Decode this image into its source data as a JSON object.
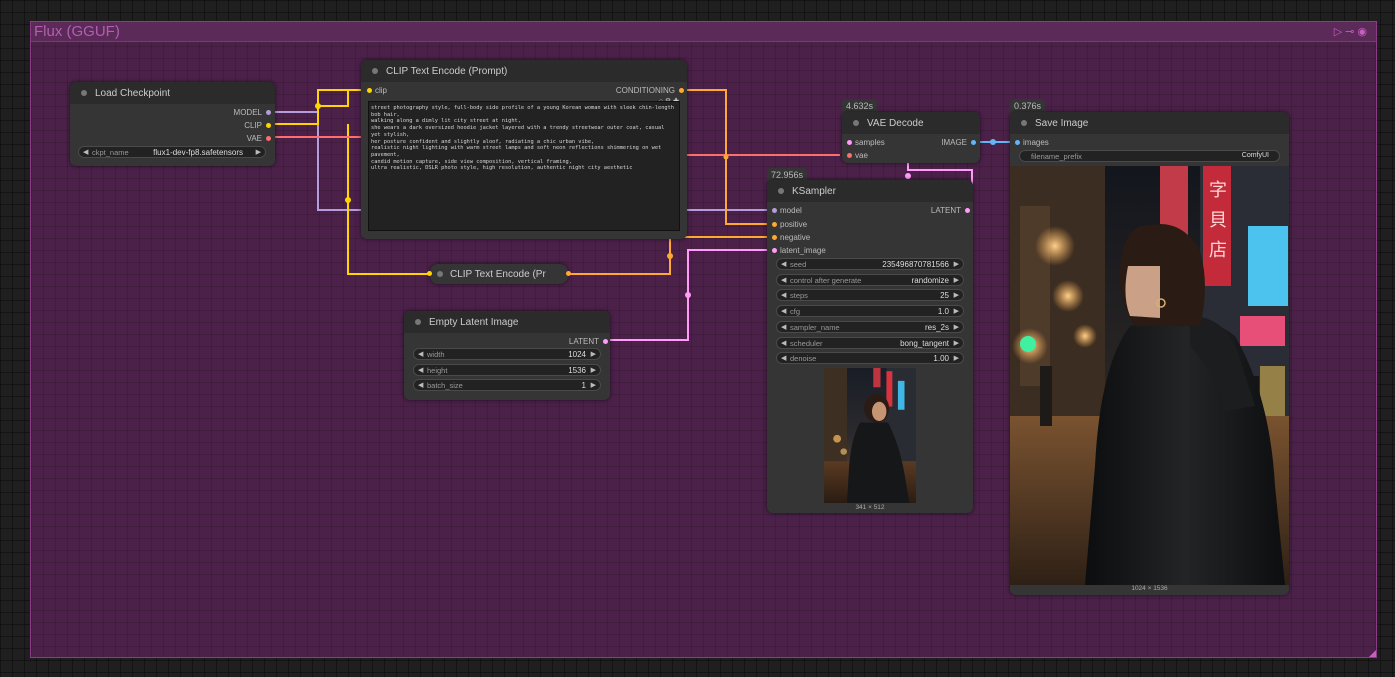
{
  "group": {
    "title": "Flux (GGUF)"
  },
  "load_checkpoint": {
    "title": "Load Checkpoint",
    "outputs": {
      "model": "MODEL",
      "clip": "CLIP",
      "vae": "VAE"
    },
    "ckpt_label": "ckpt_name",
    "ckpt_value": "flux1-dev-fp8.safetensors"
  },
  "clip_encode": {
    "title": "CLIP Text Encode (Prompt)",
    "input_clip": "clip",
    "output": "CONDITIONING",
    "prompt": "street photography style, full-body side profile of a young Korean woman with sleek chin-length bob hair,\nwalking along a dimly lit city street at night,\nshe wears a dark oversized hoodie jacket layered with a trendy streetwear outer coat, casual yet stylish,\nher posture confident and slightly aloof, radiating a chic urban vibe,\nrealistic night lighting with warm street lamps and soft neon reflections shimmering on wet pavement,\ncandid motion capture, side view composition, vertical framing,\nultra realistic, DSLR photo style, high resolution, authentic night city aesthetic"
  },
  "clip_encode_collapsed": {
    "title": "CLIP Text Encode (Pr"
  },
  "empty_latent": {
    "title": "Empty Latent Image",
    "output": "LATENT",
    "width_label": "width",
    "width_value": "1024",
    "height_label": "height",
    "height_value": "1536",
    "batch_label": "batch_size",
    "batch_value": "1"
  },
  "vae_decode": {
    "badge": "4.632s",
    "title": "VAE Decode",
    "inputs": {
      "samples": "samples",
      "vae": "vae"
    },
    "output": "IMAGE"
  },
  "ksampler": {
    "badge": "72.956s",
    "title": "KSampler",
    "inputs": {
      "model": "model",
      "positive": "positive",
      "negative": "negative",
      "latent_image": "latent_image"
    },
    "output": "LATENT",
    "widgets": [
      {
        "label": "seed",
        "value": "235496870781566"
      },
      {
        "label": "control after generate",
        "value": "randomize"
      },
      {
        "label": "steps",
        "value": "25"
      },
      {
        "label": "cfg",
        "value": "1.0"
      },
      {
        "label": "sampler_name",
        "value": "res_2s"
      },
      {
        "label": "scheduler",
        "value": "bong_tangent"
      },
      {
        "label": "denoise",
        "value": "1.00"
      }
    ],
    "preview_size": "341 × 512"
  },
  "save_image": {
    "badge": "0.376s",
    "title": "Save Image",
    "input": "images",
    "prefix_label": "filename_prefix",
    "prefix_value": "ComfyUI",
    "image_size": "1024 × 1536"
  },
  "colors": {
    "model": "#b39ddb",
    "clip": "#ffd500",
    "vae": "#ff6e6e",
    "conditioning": "#ffa931",
    "latent": "#ff9cf9",
    "image": "#64b5f6",
    "group": "#b25fb0"
  },
  "icons": {
    "run": "play-icon",
    "link": "link-icon",
    "visible": "eye-icon"
  }
}
